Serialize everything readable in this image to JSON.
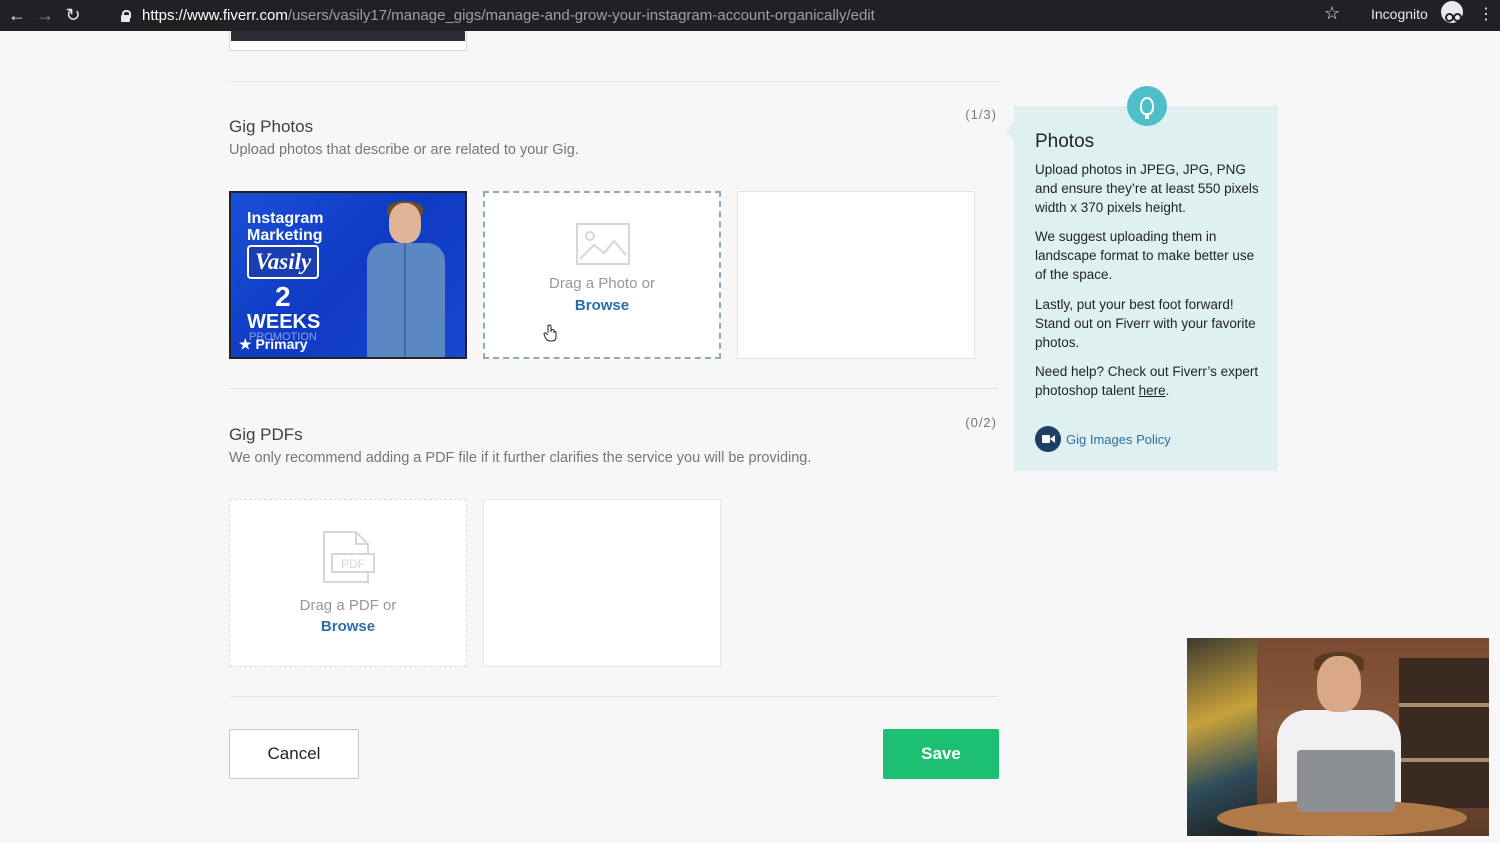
{
  "browser": {
    "url_host": "https://www.fiverr.com",
    "url_path": "/users/vasily17/manage_gigs/manage-and-grow-your-instagram-account-organically/edit",
    "profile_label": "Incognito"
  },
  "gig_photos": {
    "title": "Gig Photos",
    "description": "Upload photos that describe or are related to your Gig.",
    "counter": "(1/3)",
    "primary_photo": {
      "line1": "Instagram",
      "line2": "Marketing",
      "small_from": "from",
      "name": "Vasily",
      "number": "2",
      "weeks": "WEEKS",
      "promo": "PROMOTION",
      "badge": "Primary"
    },
    "upload_tile": {
      "drop_text": "Drag a Photo or",
      "browse": "Browse"
    }
  },
  "gig_pdfs": {
    "title": "Gig PDFs",
    "description": "We only recommend adding a PDF file if it further clarifies the service you will be providing.",
    "counter": "(0/2)",
    "upload_tile": {
      "pdf_label": "PDF",
      "drop_text": "Drag a PDF or",
      "browse": "Browse"
    }
  },
  "tip": {
    "title": "Photos",
    "p1": "Upload photos in JPEG, JPG, PNG and ensure they’re at least 550 pixels width x 370 pixels height.",
    "p2": "We suggest uploading them in landscape format to make better use of the space.",
    "p3": "Lastly, put your best foot forward! Stand out on Fiverr with your favorite photos.",
    "p4_prefix": "Need help? Check out Fiverr’s expert photoshop talent ",
    "p4_link": "here",
    "p4_suffix": ".",
    "policy_link": "Gig Images Policy",
    "accent_color": "#4ebfc9"
  },
  "actions": {
    "cancel_label": "Cancel",
    "save_label": "Save",
    "save_color": "#1dbf73"
  }
}
